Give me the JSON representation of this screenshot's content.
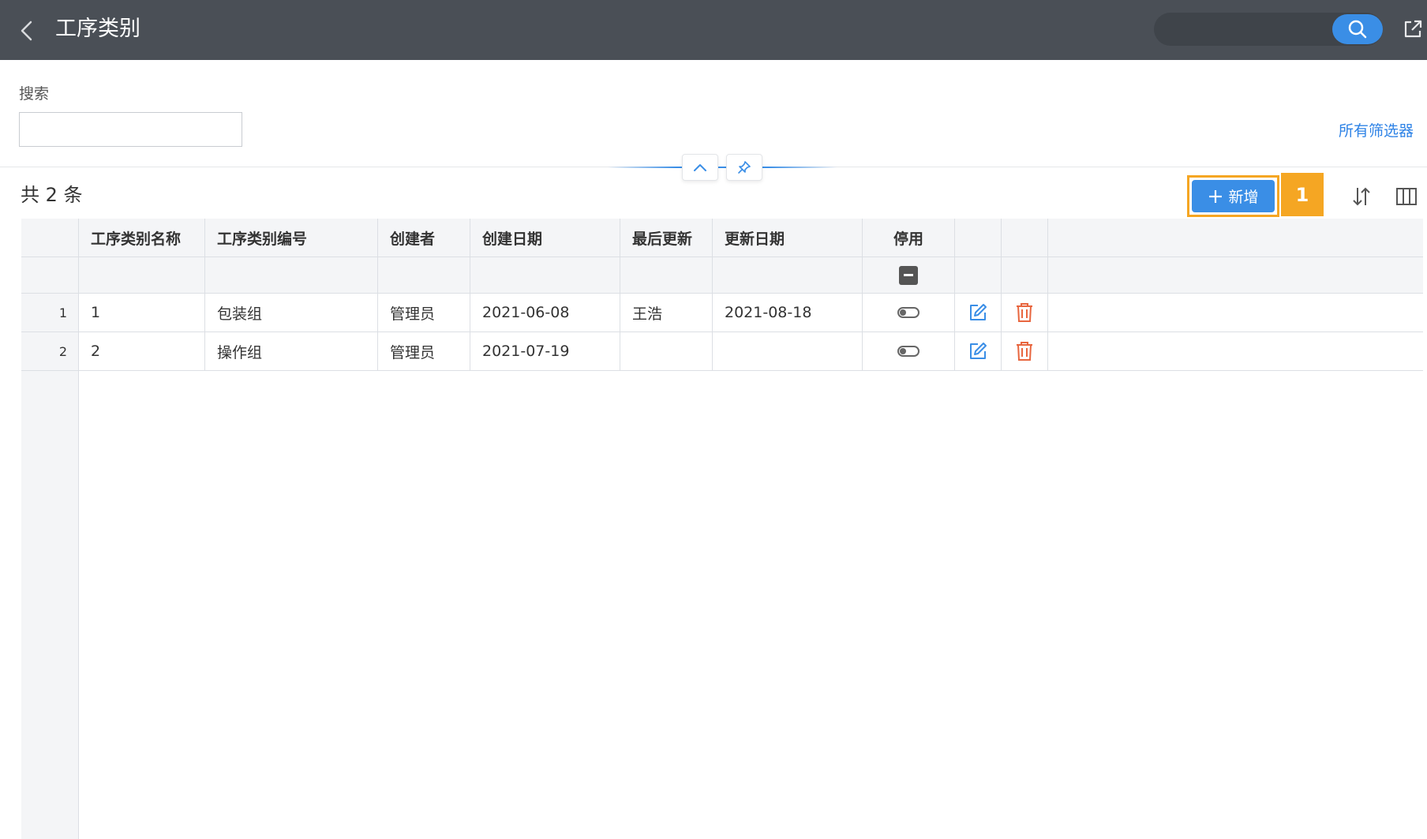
{
  "header": {
    "title": "工序类别",
    "back_icon": "chevron-left-icon",
    "search_icon": "search-icon",
    "export_icon": "external-link-icon",
    "background_color": "#4a4f56",
    "accent_color": "#3a8ee6"
  },
  "filters": {
    "search_label": "搜索",
    "search_value": "",
    "all_filters_label": "所有筛选器"
  },
  "toolbar": {
    "count_text": "共 2 条",
    "add_label": "新增",
    "step_badge": "1",
    "highlight_color": "#f5a623",
    "sort_icon": "sort-icon",
    "columns_icon": "columns-icon"
  },
  "table": {
    "columns": [
      "工序类别名称",
      "工序类别编号",
      "创建者",
      "创建日期",
      "最后更新",
      "更新日期",
      "停用"
    ],
    "rows": [
      {
        "index": "1",
        "name": "1",
        "code": "包装组",
        "creator": "管理员",
        "created": "2021-06-08",
        "last_updated_by": "王浩",
        "updated": "2021-08-18",
        "disabled": false
      },
      {
        "index": "2",
        "name": "2",
        "code": "操作组",
        "creator": "管理员",
        "created": "2021-07-19",
        "last_updated_by": "",
        "updated": "",
        "disabled": false
      }
    ],
    "delete_color": "#e8663f",
    "edit_color": "#3a8ee6"
  }
}
